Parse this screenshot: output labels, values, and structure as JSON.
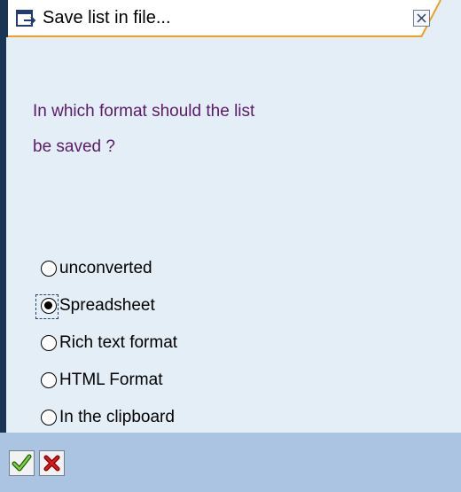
{
  "window": {
    "title": "Save list in file...",
    "icon": "edit-window-icon"
  },
  "dialog": {
    "question_line1": "In which format should the list",
    "question_line2": "be saved ?"
  },
  "options": [
    {
      "label": "unconverted",
      "selected": false
    },
    {
      "label": "Spreadsheet",
      "selected": true
    },
    {
      "label": "Rich text format",
      "selected": false
    },
    {
      "label": "HTML Format",
      "selected": false
    },
    {
      "label": "In the clipboard",
      "selected": false
    }
  ],
  "footer": {
    "ok_icon": "checkmark-icon",
    "cancel_icon": "cross-icon"
  },
  "colors": {
    "question_text": "#5a1a6a",
    "accent": "#f0a020",
    "titlebar_dark": "#1a3456",
    "body_bg": "#e4eef7",
    "footer_bg": "#aac4e2"
  }
}
